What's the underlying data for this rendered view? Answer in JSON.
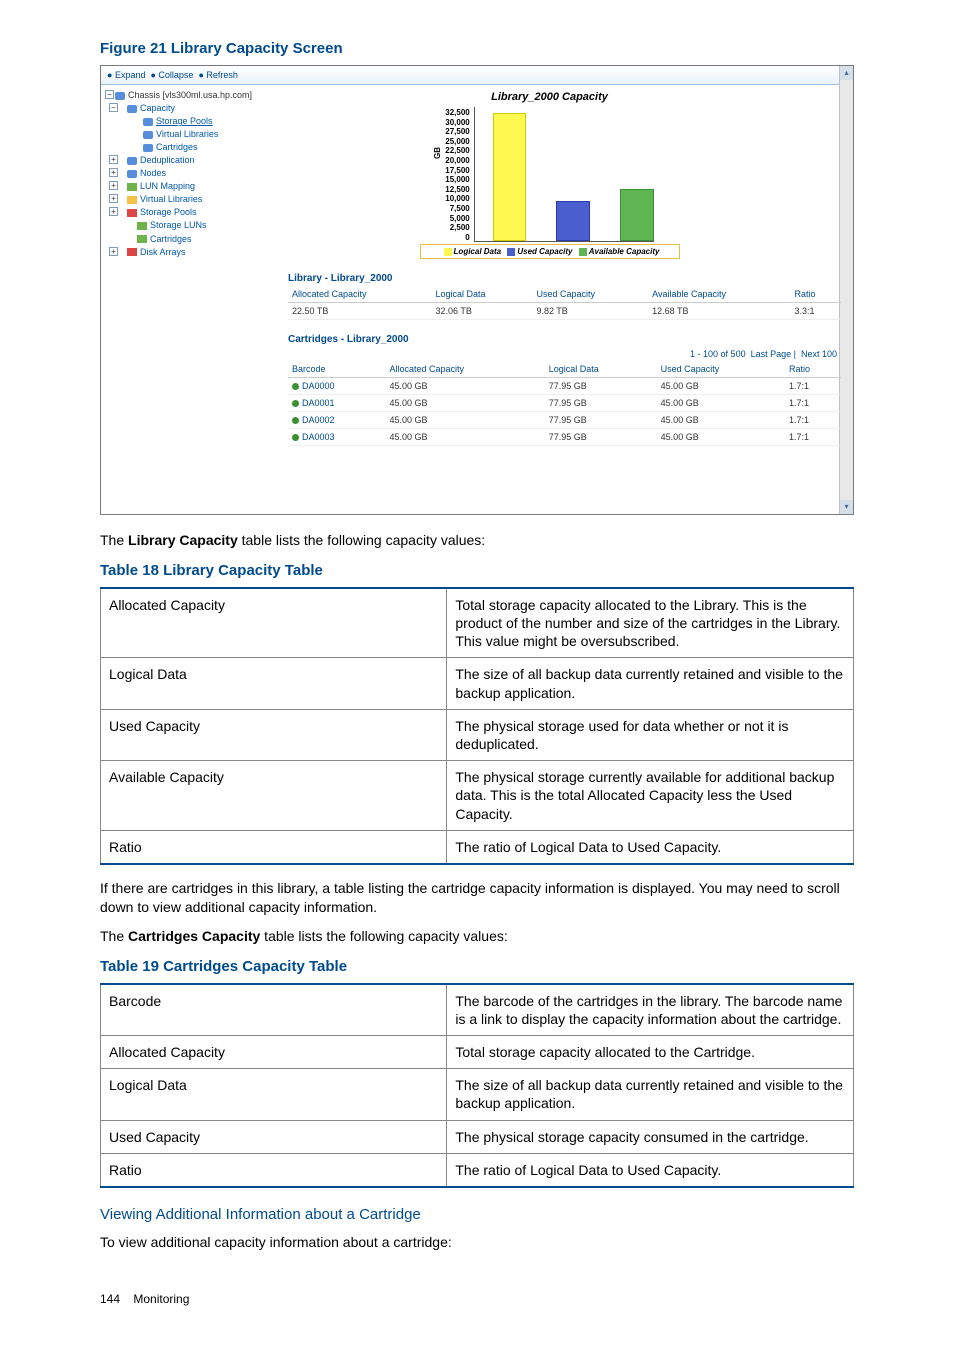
{
  "figure": {
    "caption": "Figure 21 Library Capacity Screen"
  },
  "screenshot": {
    "toolbar": {
      "expand": "Expand",
      "collapse": "Collapse",
      "refresh": "Refresh"
    },
    "tree": {
      "root": "Chassis [vls300ml.usa.hp.com]",
      "capacity": "Capacity",
      "storage_pools": "Storage Pools",
      "virtual_libraries_top": "Virtual Libraries",
      "cartridges_top": "Cartridges",
      "deduplication": "Deduplication",
      "nodes": "Nodes",
      "lun_mapping": "LUN Mapping",
      "virtual_libraries": "Virtual Libraries",
      "storage_pools2": "Storage Pools",
      "storage_luns": "Storage LUNs",
      "cartridges": "Cartridges",
      "disk_arrays": "Disk Arrays"
    },
    "chart": {
      "title": "Library_2000 Capacity",
      "gb_label": "GB",
      "ticks": [
        "32,500",
        "30,000",
        "27,500",
        "25,000",
        "22,500",
        "20,000",
        "17,500",
        "15,000",
        "12,500",
        "10,000",
        "7,500",
        "5,000",
        "2,500",
        "0"
      ],
      "legend": {
        "logical": "Logical Data",
        "used": "Used Capacity",
        "available": "Available Capacity"
      }
    },
    "library_section": {
      "header": "Library - Library_2000",
      "columns": {
        "allocated": "Allocated Capacity",
        "logical": "Logical Data",
        "used": "Used Capacity",
        "available": "Available Capacity",
        "ratio": "Ratio"
      },
      "row": {
        "allocated": "22.50 TB",
        "logical": "32.06 TB",
        "used": "9.82 TB",
        "available": "12.68 TB",
        "ratio": "3.3:1"
      }
    },
    "cartridges_section": {
      "header": "Cartridges - Library_2000",
      "pager": {
        "range": "1 - 100 of 500",
        "last": "Last Page",
        "next": "Next 100"
      },
      "columns": {
        "barcode": "Barcode",
        "allocated": "Allocated Capacity",
        "logical": "Logical Data",
        "used": "Used Capacity",
        "ratio": "Ratio"
      },
      "rows": [
        {
          "barcode": "DA0000",
          "allocated": "45.00 GB",
          "logical": "77.95 GB",
          "used": "45.00 GB",
          "ratio": "1.7:1"
        },
        {
          "barcode": "DA0001",
          "allocated": "45.00 GB",
          "logical": "77.95 GB",
          "used": "45.00 GB",
          "ratio": "1.7:1"
        },
        {
          "barcode": "DA0002",
          "allocated": "45.00 GB",
          "logical": "77.95 GB",
          "used": "45.00 GB",
          "ratio": "1.7:1"
        },
        {
          "barcode": "DA0003",
          "allocated": "45.00 GB",
          "logical": "77.95 GB",
          "used": "45.00 GB",
          "ratio": "1.7:1"
        }
      ]
    }
  },
  "intro_library": {
    "pre": "The ",
    "strong": "Library Capacity",
    "post": " table lists the following capacity values:"
  },
  "table18": {
    "caption": "Table 18 Library Capacity Table",
    "rows": [
      {
        "term": "Allocated Capacity",
        "desc": "Total storage capacity allocated to the Library. This is the product of the number and size of the cartridges in the Library. This value might be oversubscribed."
      },
      {
        "term": "Logical Data",
        "desc": "The size of all backup data currently retained and visible to the backup application."
      },
      {
        "term": "Used Capacity",
        "desc": "The physical storage used for data whether or not it is deduplicated."
      },
      {
        "term": "Available Capacity",
        "desc": "The physical storage currently available for additional backup data. This is the total Allocated Capacity less the Used Capacity."
      },
      {
        "term": "Ratio",
        "desc": "The ratio of Logical Data to Used Capacity."
      }
    ]
  },
  "mid_paragraph": "If there are cartridges in this library, a table listing the cartridge capacity information is displayed. You may need to scroll down to view additional capacity information.",
  "intro_cartridges": {
    "pre": "The ",
    "strong": "Cartridges Capacity",
    "post": " table lists the following capacity values:"
  },
  "table19": {
    "caption": "Table 19 Cartridges Capacity Table",
    "rows": [
      {
        "term": "Barcode",
        "desc": "The barcode of the cartridges in the library. The barcode name is a link to display the capacity information about the cartridge."
      },
      {
        "term": "Allocated Capacity",
        "desc": "Total storage capacity allocated to the Cartridge."
      },
      {
        "term": "Logical Data",
        "desc": "The size of all backup data currently retained and visible to the backup application."
      },
      {
        "term": "Used Capacity",
        "desc": "The physical storage capacity consumed in the cartridge."
      },
      {
        "term": "Ratio",
        "desc": "The ratio of Logical Data to Used Capacity."
      }
    ]
  },
  "sub_heading": "Viewing Additional Information about a Cartridge",
  "sub_text": "To view additional capacity information about a cartridge:",
  "footer": {
    "page": "144",
    "section": "Monitoring"
  },
  "chart_data": {
    "type": "bar",
    "title": "Library_2000 Capacity",
    "ylabel": "GB",
    "ylim": [
      0,
      32500
    ],
    "categories": [
      "Logical Data",
      "Used Capacity",
      "Available Capacity"
    ],
    "values": [
      32060,
      9820,
      12680
    ]
  }
}
